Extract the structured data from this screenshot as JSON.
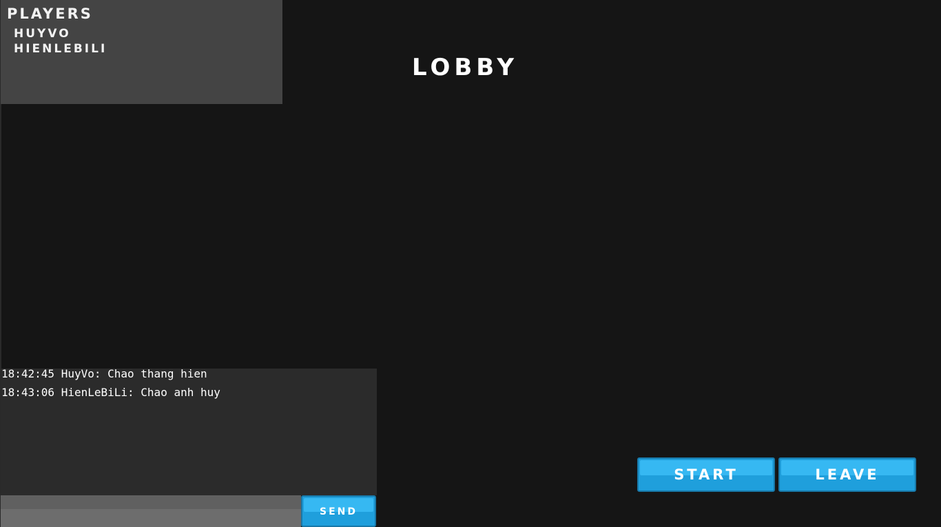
{
  "players_panel": {
    "title": "Players",
    "players": [
      "HuyVo",
      "HienLeBiLi"
    ]
  },
  "lobby": {
    "title": "Lobby"
  },
  "chat": {
    "messages": [
      "18:42:45 HuyVo: Chao thang hien",
      "18:43:06 HienLeBiLi: Chao anh huy"
    ],
    "input_value": "",
    "send_label": "Send"
  },
  "actions": {
    "start_label": "Start",
    "leave_label": "Leave"
  },
  "colors": {
    "background": "#151515",
    "panel": "#444444",
    "chat_bg": "#2b2b2b",
    "input_bg": "#6d6d6d",
    "button_accent": "#1f9fdc",
    "button_highlight": "#36b8f2"
  }
}
